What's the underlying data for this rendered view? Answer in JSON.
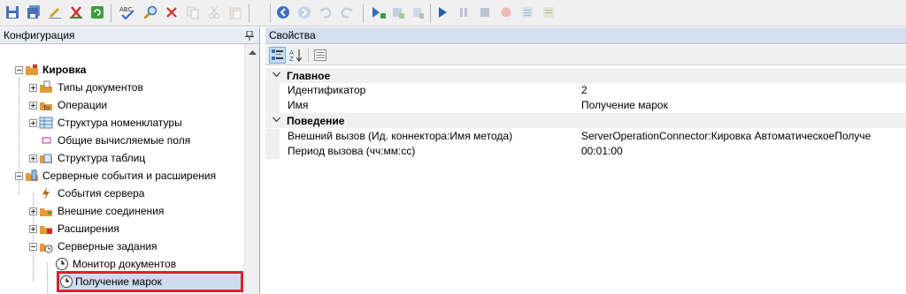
{
  "left_panel": {
    "title": "Конфигурация",
    "tree": [
      {
        "label": "Кировка",
        "bold": true,
        "icon": "folder-icon"
      },
      {
        "label": "Типы документов",
        "icon": "document-types-icon"
      },
      {
        "label": "Операции",
        "icon": "operations-icon"
      },
      {
        "label": "Структура номенклатуры",
        "icon": "table-icon"
      },
      {
        "label": "Общие вычисляемые поля",
        "icon": "fields-icon"
      },
      {
        "label": "Структура таблиц",
        "icon": "table-structure-icon"
      },
      {
        "label": "Серверные события и расширения",
        "icon": "server-icon"
      },
      {
        "label": "События сервера",
        "icon": "lightning-icon"
      },
      {
        "label": "Внешние соединения",
        "icon": "connections-icon"
      },
      {
        "label": "Расширения",
        "icon": "extensions-icon"
      },
      {
        "label": "Серверные задания",
        "icon": "clock-folder-icon"
      },
      {
        "label": "Монитор документов",
        "icon": "clock-icon"
      },
      {
        "label": "Получение марок",
        "icon": "clock-icon",
        "selected": true
      }
    ]
  },
  "right_panel": {
    "title": "Свойства",
    "categories": [
      {
        "name": "Главное",
        "properties": [
          {
            "name": "Идентификатор",
            "value": "2"
          },
          {
            "name": "Имя",
            "value": "Получение марок"
          }
        ]
      },
      {
        "name": "Поведение",
        "properties": [
          {
            "name": "Внешний вызов (Ид. коннектора:Имя метода)",
            "value": "ServerOperationConnector:Кировка АвтоматическоеПолуче"
          },
          {
            "name": "Период вызова (чч:мм:сс)",
            "value": "00:01:00"
          }
        ]
      }
    ]
  },
  "colors": {
    "highlight": "#e0202a",
    "pane_header": "#d5e0ef"
  }
}
